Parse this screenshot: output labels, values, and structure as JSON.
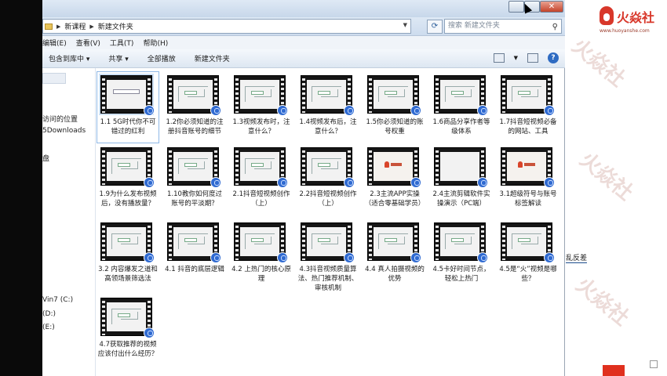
{
  "breadcrumb": {
    "items": [
      "新课程",
      "新建文件夹"
    ]
  },
  "search": {
    "placeholder": "搜索 新建文件夹"
  },
  "menu": {
    "items": [
      "编辑(E)",
      "查看(V)",
      "工具(T)",
      "帮助(H)"
    ]
  },
  "toolbar": {
    "include": "包含到库中 ▾",
    "share": "共享 ▾",
    "slideshow": "全部播放",
    "new_folder": "新建文件夹"
  },
  "nav": {
    "items": [
      "访问的位置",
      "5Downloads",
      "盘",
      "Vin7  (C:)",
      "(D:)",
      "(E:)"
    ]
  },
  "files": [
    {
      "label": "1.1 5G时代你不可错过的红利",
      "thumb": "text"
    },
    {
      "label": "1.2你必须知道的注册抖音账号的细节",
      "thumb": "mind"
    },
    {
      "label": "1.3视频发布时，注意什么？",
      "thumb": "mind"
    },
    {
      "label": "1.4视频发布后，注意什么？",
      "thumb": "mind"
    },
    {
      "label": "1.5你必须知道的账号权重",
      "thumb": "mind"
    },
    {
      "label": "1.6商品分享作者等级体系",
      "thumb": "mind"
    },
    {
      "label": "1.7抖音短视频必备的网站、工具",
      "thumb": "mind"
    },
    {
      "label": "1.9为什么发布视频后，没有播放量？",
      "thumb": "mind"
    },
    {
      "label": "1.10教你如何度过账号的平淡期？",
      "thumb": "mind"
    },
    {
      "label": "2.1抖音短视频创作（上）",
      "thumb": "mind"
    },
    {
      "label": "2.2抖音短视频创作（上）",
      "thumb": "mind"
    },
    {
      "label": "2.3主流APP实操（适合零基础学员）",
      "thumb": "logo"
    },
    {
      "label": "2.4主流剪辑软件实操演示（PC端）",
      "thumb": "blank"
    },
    {
      "label": "3.1超级符号与账号标签解读",
      "thumb": "logo"
    },
    {
      "label": "3.2 内容爆发之道和高领场景筛选法",
      "thumb": "mind"
    },
    {
      "label": "4.1 抖音的底层逻辑",
      "thumb": "mind"
    },
    {
      "label": "4.2 上热门的核心原理",
      "thumb": "mind"
    },
    {
      "label": "4.3抖音视频质量算法、热门推荐机制、审核机制",
      "thumb": "mind"
    },
    {
      "label": "4.4 真人拍摄视频的优势",
      "thumb": "mind"
    },
    {
      "label": "4.5卡好时间节点，轻松上热门",
      "thumb": "mind"
    },
    {
      "label": "4.5是“火”视频是哪些？",
      "thumb": "mind"
    },
    {
      "label": "4.7获取推荐的视频应该付出什么经历？",
      "thumb": "mind"
    }
  ],
  "brand": {
    "name": "火焱社",
    "url": "www.huoyanshe.com"
  },
  "side": {
    "text": "乱反差"
  },
  "watermark": {
    "text": "火焱社"
  }
}
